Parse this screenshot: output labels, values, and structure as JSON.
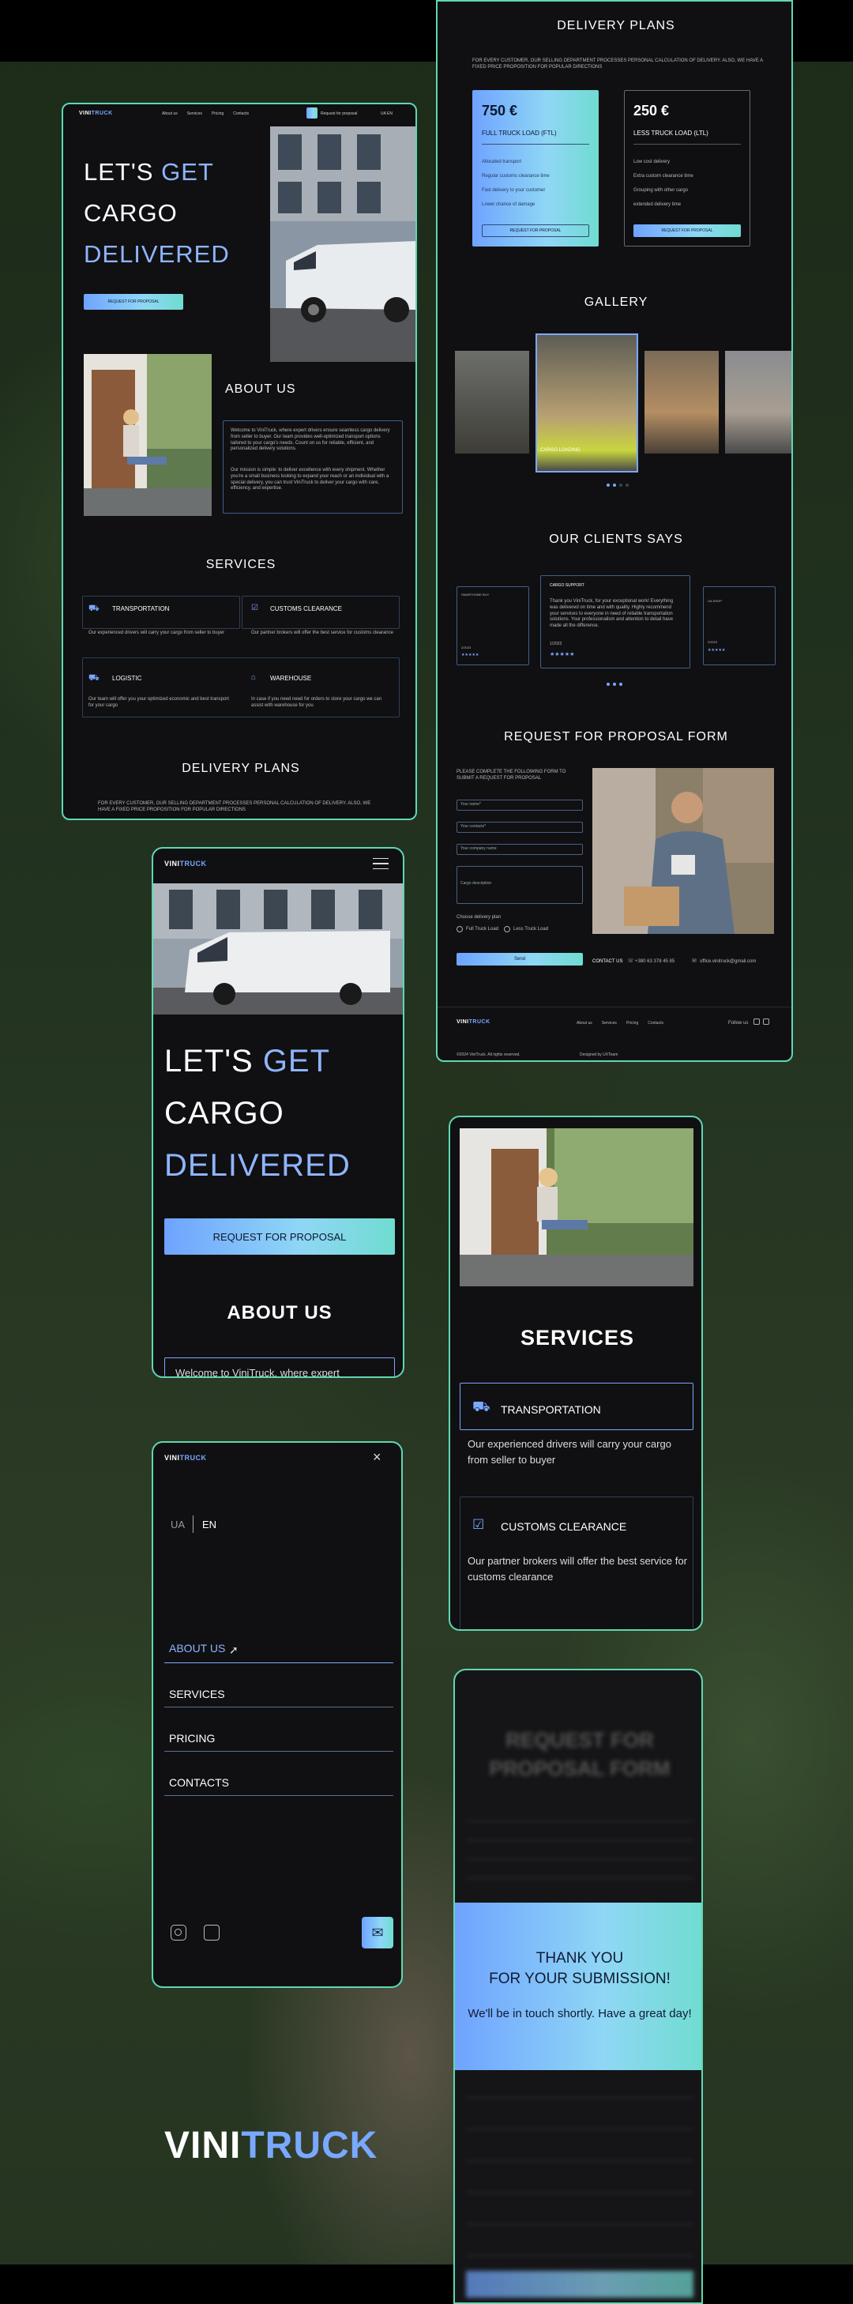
{
  "brand": {
    "part1": "VINI",
    "part2": "TRUCK"
  },
  "desktop": {
    "nav": [
      "About us",
      "Services",
      "Pricing",
      "Contacts"
    ],
    "request_btn": "Request for proposal",
    "lang": "UA EN",
    "hero": {
      "w1": "LET'S",
      "w2": "GET",
      "w3": "CARGO",
      "w4": "DELIVERED",
      "btn": "REQUEST FOR PROPOSAL"
    },
    "about": {
      "title": "ABOUT US",
      "p1": "Welcome to ViniTruck, where expert drivers ensure seamless cargo delivery from seller to buyer. Our team provides well-optimized transport options tailored to your cargo's needs. Count on us for reliable, efficient, and personalized delivery solutions.",
      "p2": "Our mission is simple: to deliver excellence with every shipment. Whether you're a small business looking to expand your reach or an individual with a special delivery, you can trust ViniTruck to deliver your cargo with care, efficiency, and expertise."
    },
    "services": {
      "title": "SERVICES",
      "items": [
        {
          "name": "TRANSPORTATION",
          "desc": "Our experienced drivers will carry your cargo from seller to buyer"
        },
        {
          "name": "CUSTOMS CLEARANCE",
          "desc": "Our partner brokers will offer the best service for customs clearance"
        },
        {
          "name": "LOGISTIC",
          "desc": "Our team will offer you your optimized economic and best transport for your cargo"
        },
        {
          "name": "WAREHOUSE",
          "desc": "In case if you need need for orders to store your cargo we can assist with warehouse for you"
        }
      ]
    },
    "plans_title": "DELIVERY PLANS",
    "plans_note": "FOR EVERY CUSTOMER, OUR SELLING DEPARTMENT PROCESSES PERSONAL CALCULATION OF DELIVERY. ALSO, WE HAVE A FIXED PRICE PROPOSITION FOR POPULAR DIRECTIONS"
  },
  "right": {
    "plans_title": "DELIVERY PLANS",
    "plans_note": "FOR EVERY CUSTOMER, OUR SELLING DEPARTMENT PROCESSES PERSONAL CALCULATION OF DELIVERY. ALSO, WE HAVE A FIXED PRICE PROPOSITION FOR POPULAR DIRECTIONS",
    "plans": [
      {
        "price": "750 €",
        "name": "FULL TRUCK LOAD (FTL)",
        "features": [
          "Allocated transport",
          "Regular customs clearance time",
          "Fast delivery to your customer",
          "Lower chance of damage"
        ],
        "btn": "REQUEST FOR PROPOSAL"
      },
      {
        "price": "250 €",
        "name": "LESS TRUCK LOAD (LTL)",
        "features": [
          "Low cost delivery",
          "Extra custom clearance time",
          "Grouping with other cargo",
          "extended delivery time"
        ],
        "btn": "REQUEST FOR PROPOSAL"
      }
    ],
    "gallery_title": "GALLERY",
    "gallery_caption": "CARGO LOADING",
    "clients_title": "OUR CLIENTS SAYS",
    "clients": [
      {
        "name": "SMARTHOME BUY",
        "date": "2/2023"
      },
      {
        "name": "CARGO SUPPORT",
        "text": "Thank you ViniTruck, for your exceptional work! Everything was delivered on time and with quality. Highly recommend your services to everyone in need of reliable transportation solutions. Your professionalism and attention to detail have made all the difference.",
        "date": "1/2023"
      },
      {
        "name": "UA SHOP",
        "date": "2/2023"
      }
    ],
    "form_title": "REQUEST FOR PROPOSAL FORM",
    "form_intro": "PLEASE COMPLETE THE FOLLOWING FORM TO SUBMIT A REQUEST FOR PROPOSAL",
    "fields": [
      "Your name*",
      "Your contacts*",
      "Your company name",
      "Cargo description"
    ],
    "delivery_label": "Choose delivery plan",
    "radio1": "Full Truck Load",
    "radio2": "Less Truck Load",
    "send": "Send",
    "contact_label": "CONTACT US",
    "phone": "+380 63 378 45 85",
    "email": "office.vinitruck@gmail.com",
    "footer_nav": [
      "About us",
      "Services",
      "Pricing",
      "Contacts"
    ],
    "follow": "Follow us",
    "copyright": "©2024 ViniTruck. All rights reserved.",
    "credit": "Designed by UXTeam"
  },
  "mobile_hero": {
    "w1": "LET'S",
    "w2": "GET",
    "w3": "CARGO",
    "w4": "DELIVERED",
    "btn": "REQUEST FOR PROPOSAL",
    "about": "ABOUT US",
    "about_peek": "Welcome to ViniTruck, where expert"
  },
  "mobile_services": {
    "title": "SERVICES",
    "items": [
      {
        "name": "TRANSPORTATION",
        "desc": "Our experienced drivers will carry your cargo from seller to buyer"
      },
      {
        "name": "CUSTOMS CLEARANCE",
        "desc": "Our partner brokers will offer the best service for customs clearance"
      }
    ]
  },
  "mobile_menu": {
    "lang_ua": "UA",
    "lang_en": "EN",
    "items": [
      "ABOUT US",
      "SERVICES",
      "PRICING",
      "CONTACTS"
    ]
  },
  "mobile_form": {
    "title1": "REQUEST FOR",
    "title2": "PROPOSAL FORM",
    "thanks1": "THANK YOU",
    "thanks2": "FOR YOUR SUBMISSION!",
    "thanks3": "We'll be in touch shortly. Have a great day!"
  },
  "colors": {
    "accent": "#79a8ff",
    "frame": "#5fd7b3",
    "panel": "#101012"
  }
}
